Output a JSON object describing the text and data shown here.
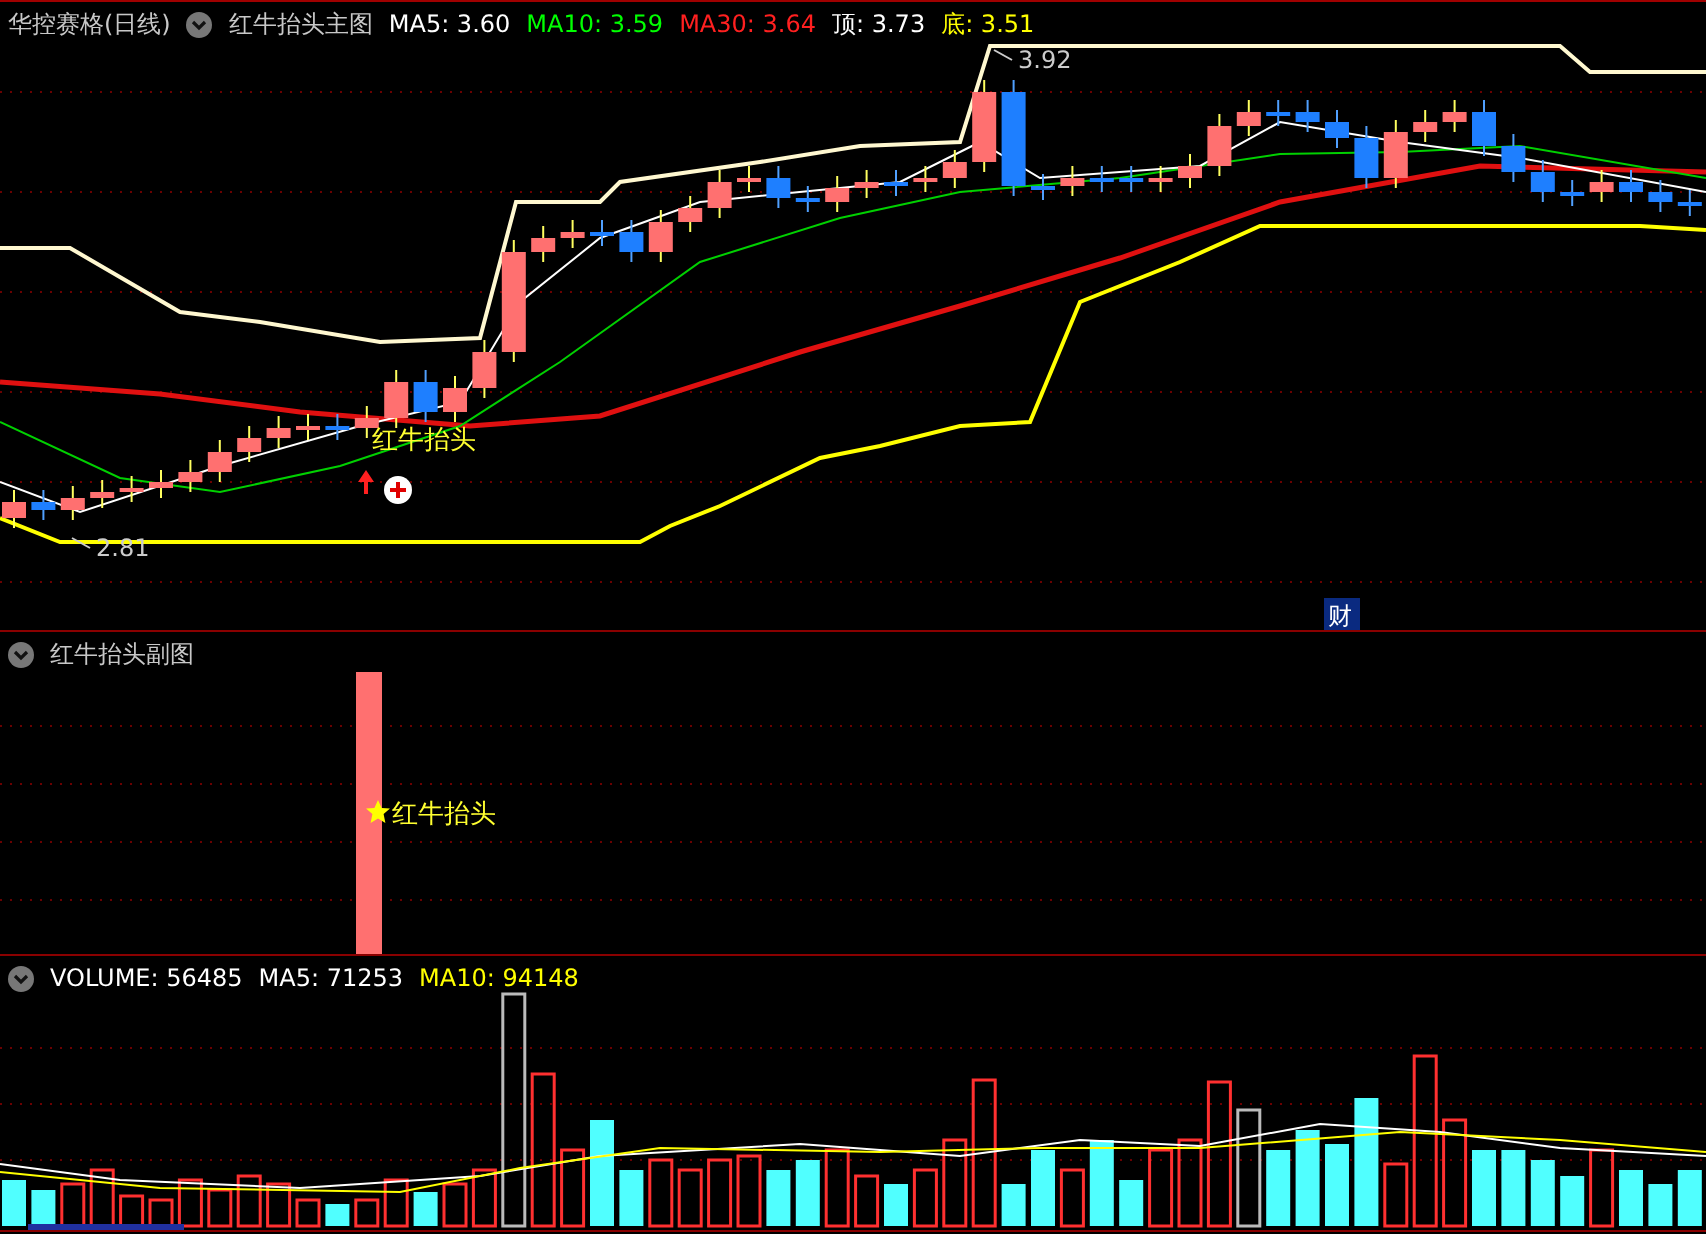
{
  "main_panel": {
    "stock": "华控赛格(日线)",
    "indicator": "红牛抬头主图",
    "legend": [
      {
        "text": "MA5: 3.60",
        "color": "#ffffff"
      },
      {
        "text": "MA10: 3.59",
        "color": "#00ff00"
      },
      {
        "text": "MA30: 3.64",
        "color": "#ff2020"
      },
      {
        "text": "顶: 3.73",
        "color": "#ffffff"
      },
      {
        "text": "底: 3.51",
        "color": "#ffff00"
      }
    ],
    "signal": "红牛抬头",
    "high_label": "3.92",
    "low_label": "2.81",
    "badge": "财"
  },
  "sub_panel": {
    "indicator": "红牛抬头副图",
    "signal": "红牛抬头"
  },
  "volume_panel": {
    "legend": [
      {
        "text": "VOLUME: 56485",
        "color": "#ffffff"
      },
      {
        "text": "MA5: 71253",
        "color": "#ffffff"
      },
      {
        "text": "MA10: 94148",
        "color": "#ffff00"
      }
    ]
  }
}
